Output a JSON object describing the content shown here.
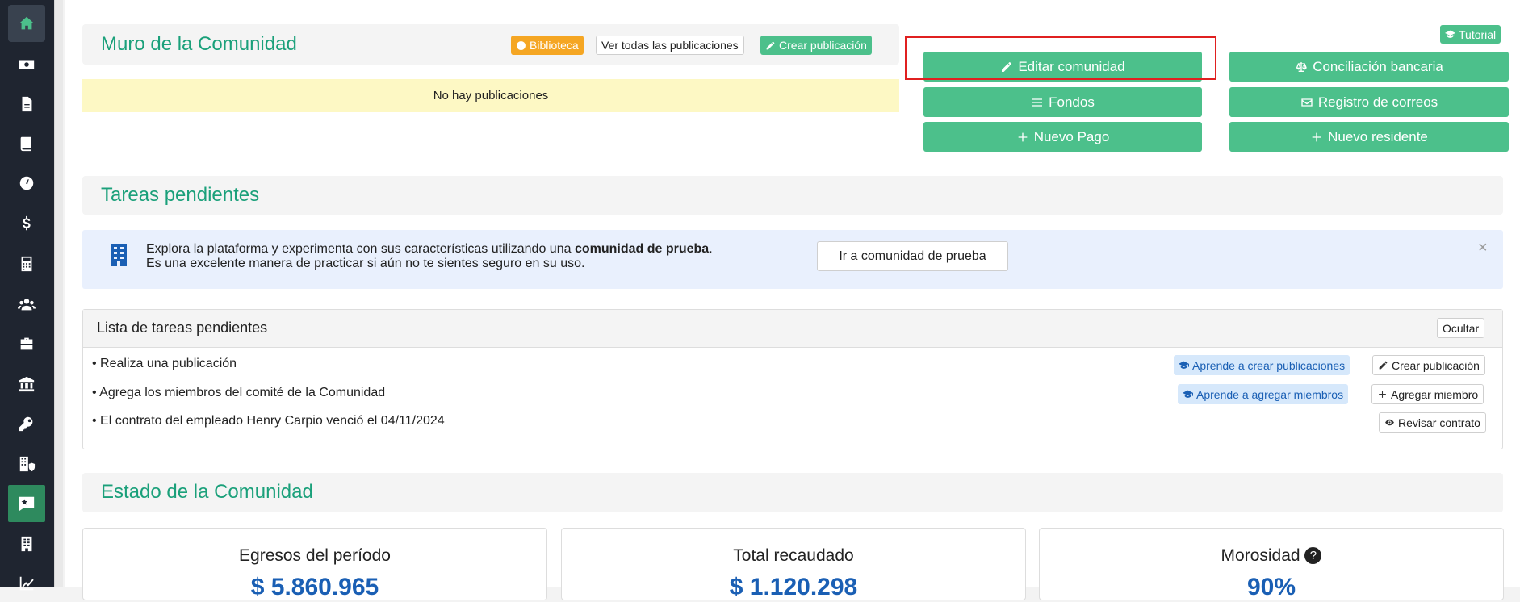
{
  "sidebar": {
    "icons": [
      "home-icon",
      "money-icon",
      "document-icon",
      "book-icon",
      "gauge-icon",
      "dollar-icon",
      "calculator-icon",
      "users-icon",
      "briefcase-icon",
      "bank-icon",
      "key-icon",
      "building-shield-icon",
      "chat-star-icon",
      "building-icon",
      "chart-line-icon"
    ]
  },
  "muro": {
    "title": "Muro de la Comunidad",
    "biblioteca": "Biblioteca",
    "ver_todas": "Ver todas las publicaciones",
    "crear": "Crear publicación",
    "empty": "No hay publicaciones"
  },
  "tutorial": "Tutorial",
  "actions": {
    "editar": "Editar comunidad",
    "conciliacion": "Conciliación bancaria",
    "fondos": "Fondos",
    "registro": "Registro de correos",
    "nuevo_pago": "Nuevo Pago",
    "nuevo_residente": "Nuevo residente"
  },
  "tareas": {
    "title": "Tareas pendientes",
    "info_line1_pre": "Explora la plataforma y experimenta con sus características utilizando una ",
    "info_line1_bold": "comunidad de prueba",
    "info_line1_post": ".",
    "info_line2": "Es una excelente manera de practicar si aún no te sientes seguro en su uso.",
    "ir_prueba": "Ir a comunidad de prueba",
    "close": "×",
    "list_title": "Lista de tareas pendientes",
    "ocultar": "Ocultar",
    "items": [
      {
        "text": "• Realiza una publicación",
        "learn": "Aprende a crear publicaciones",
        "action": "Crear publicación"
      },
      {
        "text": "• Agrega los miembros del comité de la Comunidad",
        "learn": "Aprende a agregar miembros",
        "action": "Agregar miembro"
      },
      {
        "text": "• El contrato del empleado Henry Carpio venció el 04/11/2024",
        "action": "Revisar contrato"
      }
    ]
  },
  "estado": {
    "title": "Estado de la Comunidad",
    "cards": [
      {
        "label": "Egresos del período",
        "value": "$ 5.860.965"
      },
      {
        "label": "Total recaudado",
        "value": "$ 1.120.298"
      },
      {
        "label": "Morosidad",
        "value": "90%"
      }
    ]
  },
  "colors": {
    "accent": "#4cc08b",
    "title": "#1aa07a",
    "warning": "#f5a623",
    "sidebar": "#1f2530",
    "highlight_box": "#e02020"
  }
}
